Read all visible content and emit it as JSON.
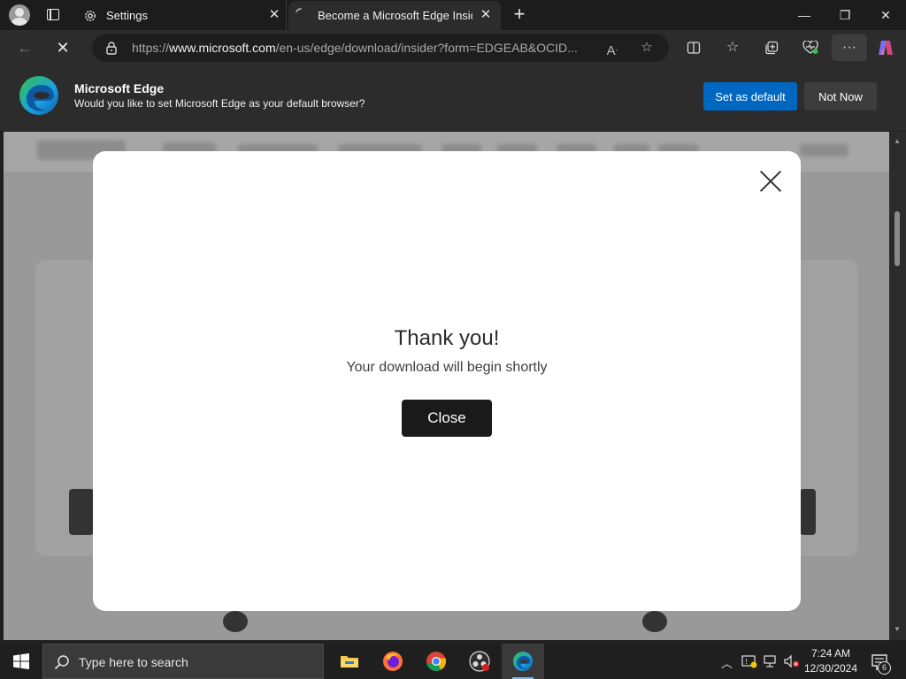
{
  "tabs": [
    {
      "title": "Settings"
    },
    {
      "title": "Become a Microsoft Edge Insider"
    }
  ],
  "address": {
    "scheme": "https://",
    "host": "www.microsoft.com",
    "path": "/en-us/edge/download/insider?form=EDGEAB&OCID..."
  },
  "infobar": {
    "title": "Microsoft Edge",
    "message": "Would you like to set Microsoft Edge as your default browser?",
    "primary_button": "Set as default",
    "secondary_button": "Not Now"
  },
  "modal": {
    "title": "Thank you!",
    "subtitle": "Your download will begin shortly",
    "close_button": "Close"
  },
  "taskbar": {
    "search_placeholder": "Type here to search",
    "time": "7:24 AM",
    "date": "12/30/2024",
    "notification_count": "6"
  },
  "colors": {
    "accent": "#0067c0",
    "edge_blue": "#0c59a4",
    "edge_green": "#35c04a"
  }
}
